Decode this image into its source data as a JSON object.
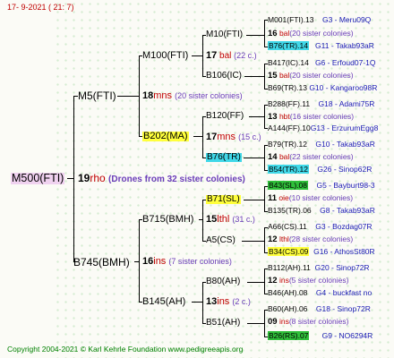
{
  "header": {
    "date": "17-  9-2021 ( 21:  7)"
  },
  "root": {
    "id": "M500(FTI)",
    "count": "19",
    "unit": "rho",
    "note": "(Drones from 32 sister colonies)"
  },
  "gen1": [
    {
      "id": "M5(FTI)"
    },
    {
      "id": "B745(BMH)",
      "count": "16",
      "unit": "ins",
      "note": "(7 sister colonies)"
    }
  ],
  "gen2": [
    {
      "id": "M100(FTI)",
      "count": "18",
      "unit": "mns",
      "note": "(20 sister colonies)"
    },
    {
      "id": "B202(MA)",
      "count": "17",
      "unit": "mns",
      "note": "(15 c.)"
    },
    {
      "id": "B715(BMH)",
      "count": "15",
      "unit": "lthl",
      "note": "(31 c.)"
    },
    {
      "id": "B145(AH)",
      "count": "13",
      "unit": "ins",
      "note": "(2 c.)"
    }
  ],
  "gen3": [
    {
      "id": "M10(FTI)",
      "count": "17",
      "unit": "bal",
      "note": "(22 c.)"
    },
    {
      "id": "B106(IC)"
    },
    {
      "id": "B120(FF)",
      "count": "17",
      "unit": "mns",
      "note": "(15 c.)"
    },
    {
      "id": "B76(TR)"
    },
    {
      "id": "B71(SL)",
      "count": "11",
      "unit": "oie",
      "note": "(10 sister colonies)"
    },
    {
      "id": "A5(CS)"
    },
    {
      "id": "B80(AH)",
      "count": "12",
      "unit": "ins",
      "note": "(5 sister colonies)"
    },
    {
      "id": "B51(AH)",
      "count": "09",
      "unit": "ins",
      "note": "(8 sister colonies)"
    }
  ],
  "gen4": [
    {
      "id": "M001(FTI).13",
      "ref": "G3 - Meru09Q"
    },
    {
      "count": "16",
      "unit": "bal",
      "note": "(20 sister colonies)"
    },
    {
      "id": "B76(TR).14",
      "ref": "G11 - Takab93aR"
    },
    {
      "id": "B417(IC).14",
      "ref": "G6 - Erfoud07-1Q"
    },
    {
      "count": "15",
      "unit": "bal",
      "note": "(20 sister colonies)"
    },
    {
      "id": "B69(TR).13",
      "ref": "G10 - Kangaroo98R"
    },
    {
      "id": "B288(FF).11",
      "ref": "G18 - Adami75R"
    },
    {
      "count": "13",
      "unit": "hbt",
      "note": "(16 sister colonies)"
    },
    {
      "id": "A144(FF).10",
      "ref": "G13 - ErzurumEgg8"
    },
    {
      "id": "B79(TR).12",
      "ref": "G10 - Takab93aR"
    },
    {
      "count": "14",
      "unit": "bal",
      "note": "(22 sister colonies)"
    },
    {
      "id": "B54(TR).12",
      "ref": "G26 - Sinop62R"
    },
    {
      "id": "B43(SL).08",
      "ref": "G5 - Bayburt98-3"
    },
    {
      "id": "B135(TR).06",
      "ref": "G8 - Takab93aR"
    },
    {
      "id": "A66(CS).11",
      "ref": "G3 - Bozdag07R"
    },
    {
      "count": "12",
      "unit": "lthl",
      "note": "(28 sister colonies)"
    },
    {
      "id": "B34(CS).09",
      "ref": "G16 - AthosSt80R"
    },
    {
      "id": "B112(AH).11",
      "ref": "G20 - Sinop72R"
    },
    {
      "id": "B46(AH).08",
      "ref": "G4 - buckfast no"
    },
    {
      "id": "B60(AH).06",
      "ref": "G18 - Sinop72R"
    },
    {
      "id": "B26(RS).07",
      "ref": "G9 - NO6294R"
    }
  ],
  "footer": {
    "copyright": "Copyright 2004-2021 © Karl Kehrle Foundation    www.pedigreeapis.org"
  },
  "colors": {
    "count": "#000000",
    "strain": "#c00000",
    "note": "#6a3db8",
    "ref": "#1a1ab4",
    "purple_box": "#f0d2f0",
    "yellow_box": "#ffff3c",
    "cyan_box": "#40d8e8",
    "green_box": "#2fbf3a",
    "footer": "#008000"
  }
}
